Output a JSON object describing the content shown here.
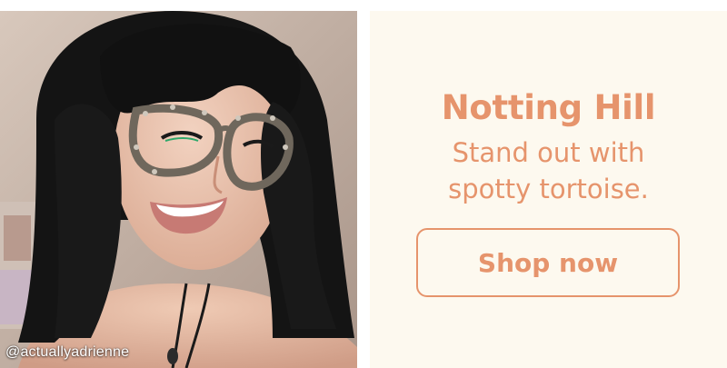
{
  "photo": {
    "credit": "@actuallyadrienne"
  },
  "promo": {
    "title": "Notting Hill",
    "tagline_line1": "Stand out with",
    "tagline_line2": "spotty tortoise.",
    "cta_label": "Shop now"
  },
  "colors": {
    "accent": "#e6946c",
    "panel_background": "#fdf9ef",
    "page_background": "#ffffff"
  }
}
